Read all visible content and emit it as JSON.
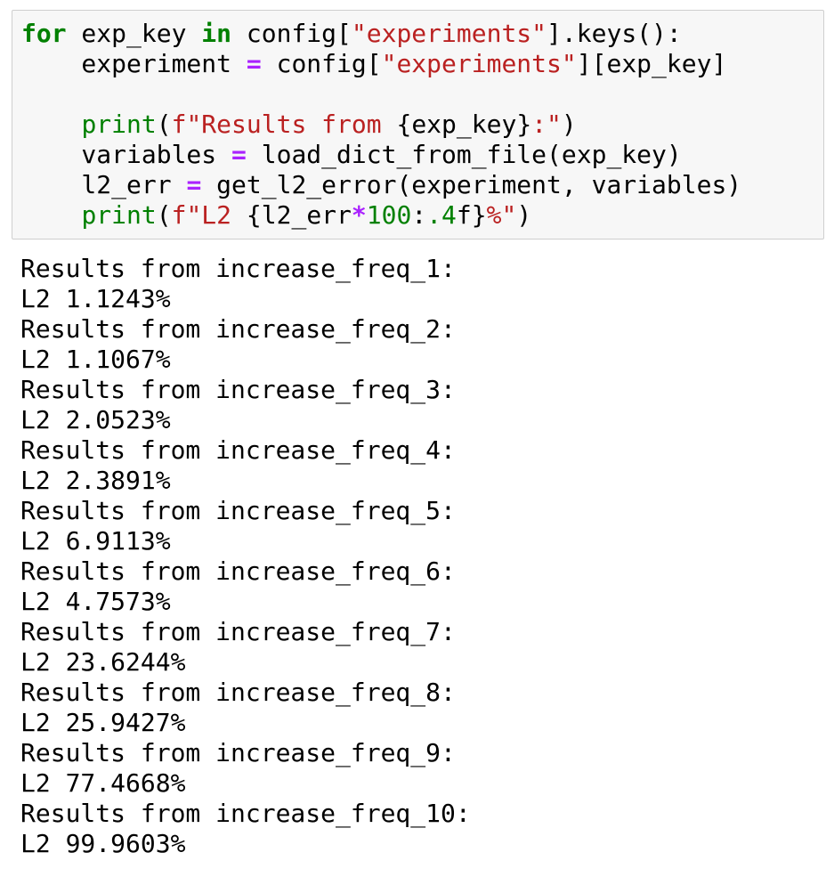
{
  "input_cell": {
    "lines": [
      [
        {
          "t": "for",
          "c": "kw"
        },
        {
          "t": " exp_key ",
          "c": ""
        },
        {
          "t": "in",
          "c": "kw"
        },
        {
          "t": " config[",
          "c": ""
        },
        {
          "t": "\"experiments\"",
          "c": "str"
        },
        {
          "t": "].keys():",
          "c": ""
        }
      ],
      [
        {
          "t": "    experiment ",
          "c": ""
        },
        {
          "t": "=",
          "c": "op"
        },
        {
          "t": " config[",
          "c": ""
        },
        {
          "t": "\"experiments\"",
          "c": "str"
        },
        {
          "t": "][exp_key]",
          "c": ""
        }
      ],
      [],
      [
        {
          "t": "    ",
          "c": ""
        },
        {
          "t": "print",
          "c": "bi"
        },
        {
          "t": "(",
          "c": ""
        },
        {
          "t": "f\"Results from ",
          "c": "fstr"
        },
        {
          "t": "{exp_key}",
          "c": ""
        },
        {
          "t": ":\"",
          "c": "fstr"
        },
        {
          "t": ")",
          "c": ""
        }
      ],
      [
        {
          "t": "    variables ",
          "c": ""
        },
        {
          "t": "=",
          "c": "op"
        },
        {
          "t": " load_dict_from_file(exp_key)",
          "c": ""
        }
      ],
      [
        {
          "t": "    l2_err ",
          "c": ""
        },
        {
          "t": "=",
          "c": "op"
        },
        {
          "t": " get_l2_error(experiment, variables)",
          "c": ""
        }
      ],
      [
        {
          "t": "    ",
          "c": ""
        },
        {
          "t": "print",
          "c": "bi"
        },
        {
          "t": "(",
          "c": ""
        },
        {
          "t": "f\"L2 ",
          "c": "fstr"
        },
        {
          "t": "{l2_err",
          "c": ""
        },
        {
          "t": "*",
          "c": "op"
        },
        {
          "t": "100",
          "c": "num"
        },
        {
          "t": ":",
          "c": ""
        },
        {
          "t": ".4",
          "c": "num"
        },
        {
          "t": "f}",
          "c": ""
        },
        {
          "t": "%\"",
          "c": "fstr"
        },
        {
          "t": ")",
          "c": ""
        }
      ]
    ]
  },
  "output": {
    "lines": [
      "Results from increase_freq_1:",
      "L2 1.1243%",
      "Results from increase_freq_2:",
      "L2 1.1067%",
      "Results from increase_freq_3:",
      "L2 2.0523%",
      "Results from increase_freq_4:",
      "L2 2.3891%",
      "Results from increase_freq_5:",
      "L2 6.9113%",
      "Results from increase_freq_6:",
      "L2 4.7573%",
      "Results from increase_freq_7:",
      "L2 23.6244%",
      "Results from increase_freq_8:",
      "L2 25.9427%",
      "Results from increase_freq_9:",
      "L2 77.4668%",
      "Results from increase_freq_10:",
      "L2 99.9603%"
    ]
  }
}
